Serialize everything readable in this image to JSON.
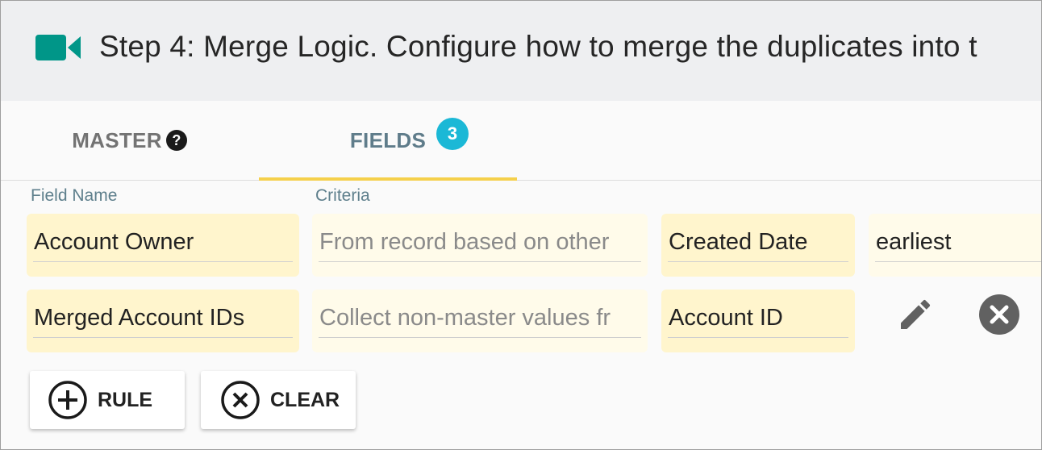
{
  "header": {
    "title": "Step 4: Merge Logic. Configure how to merge the duplicates into t",
    "icon": "video-camera-icon",
    "accent_color": "#009688"
  },
  "tabs": [
    {
      "label": "MASTER",
      "icon": "help-circle-icon",
      "active": false
    },
    {
      "label": "FIELDS",
      "badge": "3",
      "active": true
    }
  ],
  "columns": {
    "field_name": "Field Name",
    "criteria": "Criteria"
  },
  "rules": [
    {
      "field_name": "Account Owner",
      "criteria_placeholder": "From record based on other",
      "reference_field": "Created Date",
      "option": "earliest"
    },
    {
      "field_name": "Merged Account IDs",
      "criteria_placeholder": "Collect non-master values fr",
      "reference_field": "Account ID"
    }
  ],
  "actions": {
    "add_rule": "RULE",
    "clear": "CLEAR"
  },
  "colors": {
    "field_bg": "#fff5cd",
    "tab_indicator": "#f5d04b",
    "badge": "#1bb8d6",
    "icon_gray": "#616161"
  }
}
